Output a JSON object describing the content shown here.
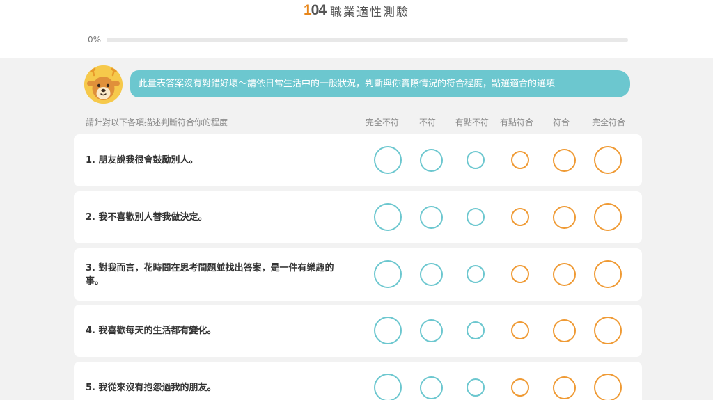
{
  "header": {
    "logo": [
      "1",
      "0",
      "4"
    ],
    "title": "職業適性測驗"
  },
  "progress": {
    "label": "0%",
    "value": 0
  },
  "guide": {
    "message": "此量表答案沒有對錯好壞～請依日常生活中的一般狀況，判斷與你實際情況的符合程度，點選適合的選項"
  },
  "instruction": "請針對以下各項描述判斷符合你的程度",
  "scale": [
    "完全不符",
    "不符",
    "有點不符",
    "有點符合",
    "符合",
    "完全符合"
  ],
  "colors": {
    "disagree": "#6cc7cf",
    "agree": "#ef9a34",
    "bubble": "#6cc7cf",
    "background": "#f2f2f2"
  },
  "questions": [
    "1. 朋友說我很會鼓勵別人。",
    "2. 我不喜歡別人替我做決定。",
    "3. 對我而言，花時間在思考問題並找出答案，是一件有樂趣的事。",
    "4. 我喜歡每天的生活都有變化。",
    "5. 我從來沒有抱怨過我的朋友。"
  ]
}
